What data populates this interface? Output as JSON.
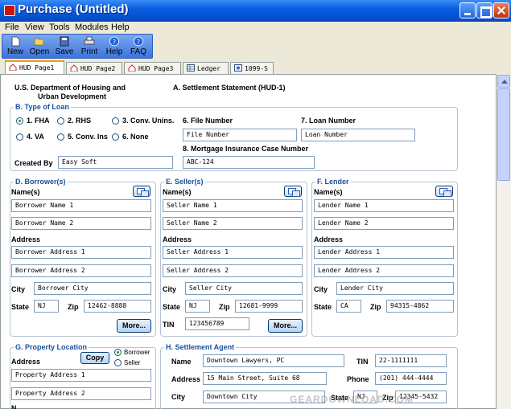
{
  "window": {
    "title": "Purchase (Untitled)"
  },
  "menu": [
    "File",
    "View",
    "Tools",
    "Modules",
    "Help"
  ],
  "toolbar": {
    "new": "New",
    "open": "Open",
    "save": "Save",
    "print": "Print",
    "help": "Help",
    "faq": "FAQ"
  },
  "tabs": [
    "HUD Page1",
    "HUD Page2",
    "HUD Page3",
    "Ledger",
    "1099-S"
  ],
  "header": {
    "dept_line1": "U.S. Department of Housing  and",
    "dept_line2": "Urban Development",
    "statement": "A. Settlement Statement (HUD-1)"
  },
  "loan": {
    "section": "B. Type of Loan",
    "options": [
      "1. FHA",
      "2. RHS",
      "3. Conv. Unins.",
      "4. VA",
      "5. Conv. Ins",
      "6. None"
    ],
    "selected": "1. FHA",
    "file_number_label": "6. File Number",
    "file_number": "File Number",
    "loan_number_label": "7. Loan Number",
    "loan_number": "Loan Number",
    "mic_label": "8. Mortgage Insurance Case Number",
    "mic": "ABC-124",
    "created_by_label": "Created By",
    "created_by": "Easy Soft"
  },
  "borrower": {
    "section": "D. Borrower(s)",
    "names_label": "Name(s)",
    "name1": "Borrower Name 1",
    "name2": "Borrower Name 2",
    "address_label": "Address",
    "address1": "Borrower Address 1",
    "address2": "Borrower Address 2",
    "city_label": "City",
    "city": "Borrower City",
    "state_label": "State",
    "state": "NJ",
    "zip_label": "Zip",
    "zip": "12462-8888",
    "more": "More..."
  },
  "seller": {
    "section": "E. Seller(s)",
    "names_label": "Name(s)",
    "name1": "Seller Name 1",
    "name2": "Seller Name 2",
    "address_label": "Address",
    "address1": "Seller Address 1",
    "address2": "Seller Address 2",
    "city_label": "City",
    "city": "Seller City",
    "state_label": "State",
    "state": "NJ",
    "zip_label": "Zip",
    "zip": "12681-9999",
    "tin_label": "TIN",
    "tin": "123456789",
    "more": "More..."
  },
  "lender": {
    "section": "F. Lender",
    "names_label": "Name(s)",
    "name1": "Lender Name 1",
    "name2": "Lender Name 2",
    "address_label": "Address",
    "address1": "Lender Address 1",
    "address2": "Lender Address 2",
    "city_label": "City",
    "city": "Lender City",
    "state_label": "State",
    "state": "CA",
    "zip_label": "Zip",
    "zip": "94315-4862"
  },
  "property": {
    "section": "G. Property Location",
    "address_label": "Address",
    "copy": "Copy",
    "radio_borrower": "Borrower",
    "radio_seller": "Seller",
    "address1": "Property Address 1",
    "address2": "Property Address 2",
    "name_partial": "N"
  },
  "agent": {
    "section": "H. Settlement Agent",
    "name_label": "Name",
    "name": "Downtown Lawyers, PC",
    "tin_label": "TIN",
    "tin": "22-1111111",
    "address_label": "Address",
    "address": "15 Main Street, Suite 68",
    "phone_label": "Phone",
    "phone": "(201) 444-4444",
    "city_label": "City",
    "city": "Downtown City",
    "state_label": "State",
    "state": "NJ",
    "zip_label": "Zip",
    "zip": "12345-5432"
  },
  "watermark": "GEARDOWNLOAD.COM",
  "colors": {
    "title_bar": "#0450d2",
    "section_heading": "#1a4fa0",
    "radio_selected": "#21a121",
    "active_tab_accent": "#e8a11a"
  }
}
